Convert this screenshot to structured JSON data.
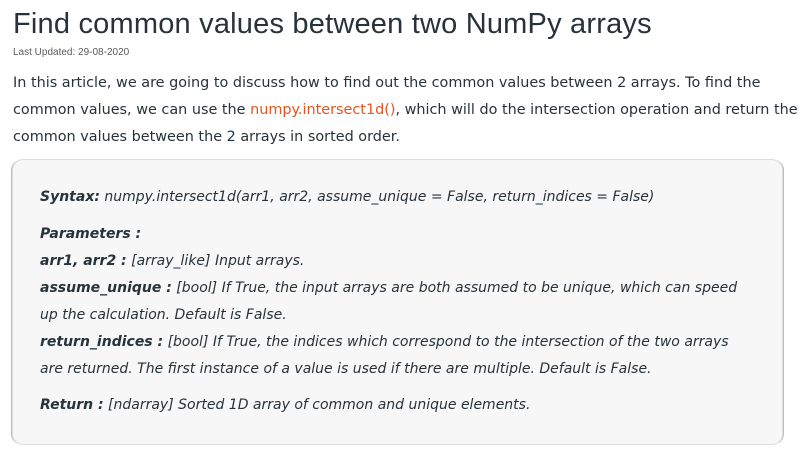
{
  "title": "Find common values between two NumPy arrays",
  "last_updated": "Last Updated: 29-08-2020",
  "intro": {
    "part1": "In this article, we are going to discuss how to find out the common values between 2 arrays. To find the common values, we can use the ",
    "link": "numpy.intersect1d()",
    "part2": ", which will do the intersection operation and return the common values between the 2 arrays in sorted order."
  },
  "box": {
    "syntax_label": "Syntax:",
    "syntax_text": " numpy.intersect1d(arr1, arr2, assume_unique = False, return_indices = False)",
    "params_label": "Parameters :",
    "params": [
      {
        "name": "arr1, arr2 :",
        "desc": " [array_like] Input arrays."
      },
      {
        "name": "assume_unique :",
        "desc": " [bool] If True, the input arrays are both assumed to be unique, which can speed up the calculation. Default is False."
      },
      {
        "name": "return_indices :",
        "desc": " [bool] If True, the indices which correspond to the intersection of the two arrays are returned. The first instance of a value is used if there are multiple. Default is False."
      }
    ],
    "return_label": "Return :",
    "return_text": " [ndarray] Sorted 1D array of common and unique elements."
  }
}
